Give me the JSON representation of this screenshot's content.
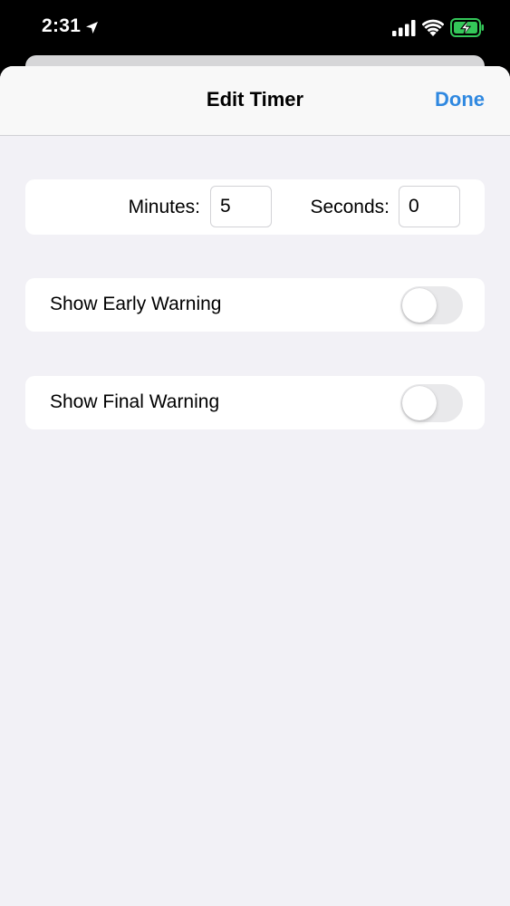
{
  "status_bar": {
    "time": "2:31",
    "icons": [
      "location-arrow-icon",
      "cellular-signal-icon",
      "wifi-icon",
      "battery-charging-icon"
    ],
    "battery_color": "#34c759"
  },
  "nav": {
    "title": "Edit Timer",
    "done_label": "Done",
    "accent_color": "#2f88e0"
  },
  "timer": {
    "minutes_label": "Minutes:",
    "minutes_value": "5",
    "seconds_label": "Seconds:",
    "seconds_value": "0"
  },
  "settings": {
    "early_warning": {
      "label": "Show Early Warning",
      "enabled": false
    },
    "final_warning": {
      "label": "Show Final Warning",
      "enabled": false
    }
  }
}
